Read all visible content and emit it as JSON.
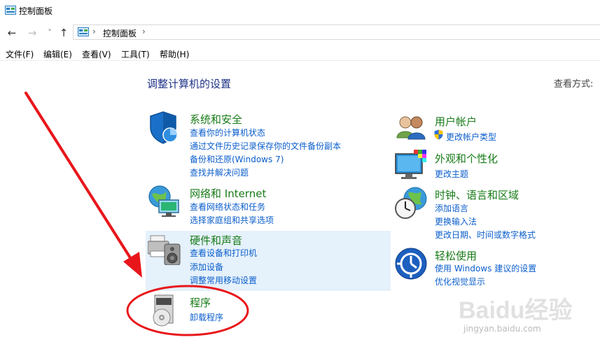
{
  "window": {
    "title": "控制面板"
  },
  "nav": {
    "back": "←",
    "forward": "→",
    "recent": "˅",
    "up": "↑",
    "chevron": "›",
    "crumb": "控制面板"
  },
  "menu": {
    "file": "文件(F)",
    "edit": "编辑(E)",
    "view": "查看(V)",
    "tools": "工具(T)",
    "help": "帮助(H)"
  },
  "main": {
    "heading": "调整计算机的设置",
    "view_by": "查看方式:"
  },
  "categories": [
    {
      "title": "系统和安全",
      "links": [
        "查看你的计算机状态",
        "通过文件历史记录保存你的文件备份副本",
        "备份和还原(Windows 7)",
        "查找并解决问题"
      ]
    },
    {
      "title": "网络和 Internet",
      "links": [
        "查看网络状态和任务",
        "选择家庭组和共享选项"
      ]
    },
    {
      "title": "硬件和声音",
      "links": [
        "查看设备和打印机",
        "添加设备",
        "调整常用移动设置"
      ]
    },
    {
      "title": "程序",
      "links": [
        "卸载程序"
      ]
    },
    {
      "title": "用户帐户",
      "links": [
        "更改帐户类型"
      ]
    },
    {
      "title": "外观和个性化",
      "links": [
        "更改主题"
      ]
    },
    {
      "title": "时钟、语言和区域",
      "links": [
        "添加语言",
        "更换输入法",
        "更改日期、时间或数字格式"
      ]
    },
    {
      "title": "轻松使用",
      "links": [
        "使用 Windows 建议的设置",
        "优化视觉显示"
      ]
    }
  ],
  "watermark": {
    "brand": "Baidu经验",
    "site": "jingyan.baidu.com"
  },
  "colors": {
    "category_title": "#187b18",
    "link": "#0b5ecc",
    "heading": "#1e3287",
    "highlight": "#e5f1fb",
    "annotation": "#e8161b"
  }
}
